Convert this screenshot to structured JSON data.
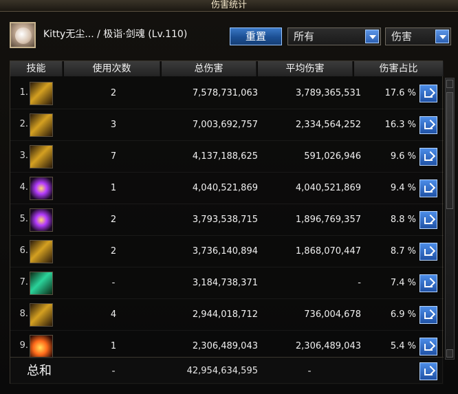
{
  "window": {
    "title": "伤害统计"
  },
  "header": {
    "character_display": "Kitty无尘... / 极诣·剑魂 (Lv.110)",
    "reset_label": "重置",
    "scope_value": "所有",
    "metric_value": "伤害"
  },
  "table": {
    "headers": {
      "skill": "技能",
      "uses": "使用次数",
      "total": "总伤害",
      "avg": "平均伤害",
      "pct": "伤害占比"
    },
    "rows": [
      {
        "index": "1.",
        "uses": "2",
        "total": "7,578,731,063",
        "avg": "3,789,365,531",
        "pct": "17.6 %"
      },
      {
        "index": "2.",
        "uses": "3",
        "total": "7,003,692,757",
        "avg": "2,334,564,252",
        "pct": "16.3 %"
      },
      {
        "index": "3.",
        "uses": "7",
        "total": "4,137,188,625",
        "avg": "591,026,946",
        "pct": "9.6 %"
      },
      {
        "index": "4.",
        "uses": "1",
        "total": "4,040,521,869",
        "avg": "4,040,521,869",
        "pct": "9.4 %"
      },
      {
        "index": "5.",
        "uses": "2",
        "total": "3,793,538,715",
        "avg": "1,896,769,357",
        "pct": "8.8 %"
      },
      {
        "index": "6.",
        "uses": "2",
        "total": "3,736,140,894",
        "avg": "1,868,070,447",
        "pct": "8.7 %"
      },
      {
        "index": "7.",
        "uses": "-",
        "total": "3,184,738,371",
        "avg": "-",
        "pct": "7.4 %"
      },
      {
        "index": "8.",
        "uses": "4",
        "total": "2,944,018,712",
        "avg": "736,004,678",
        "pct": "6.9 %"
      },
      {
        "index": "9.",
        "uses": "1",
        "total": "2,306,489,043",
        "avg": "2,306,489,043",
        "pct": "5.4 %"
      }
    ],
    "summary": {
      "label": "总和",
      "uses": "-",
      "total": "42,954,634,595",
      "avg": "-"
    }
  },
  "icons": {
    "skill_icons": [
      "skill-sword-icon",
      "skill-slash-icon",
      "skill-charge-icon",
      "skill-burst-icon",
      "skill-strike-icon",
      "skill-wave-icon",
      "skill-kanji-icon",
      "skill-sweep-icon",
      "skill-flash-icon"
    ],
    "share": "share-icon",
    "dropdown": "chevron-down-icon"
  },
  "colors": {
    "accent_blue": "#2052a6",
    "text_primary": "#f0f0f0"
  }
}
